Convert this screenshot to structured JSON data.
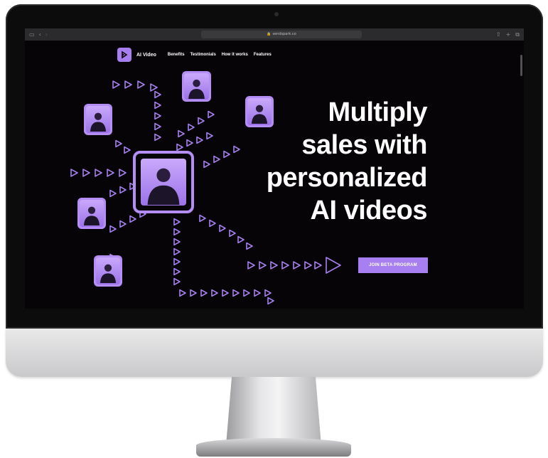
{
  "browser": {
    "url": "sendspark.co",
    "toolbar_icons": [
      "sidebar-icon",
      "back-icon",
      "forward-icon",
      "share-icon",
      "new-tab-icon",
      "tabs-icon"
    ]
  },
  "nav": {
    "brand": "AI Video",
    "links": [
      "Benefits",
      "Testimonials",
      "How it works",
      "Features"
    ]
  },
  "hero": {
    "title_lines": [
      "Multiply",
      "sales with",
      "personalized",
      "AI videos"
    ],
    "cta_label": "JOIN BETA PROGRAM"
  },
  "colors": {
    "accent": "#a77ff0",
    "background": "#060406",
    "text": "#ffffff"
  }
}
